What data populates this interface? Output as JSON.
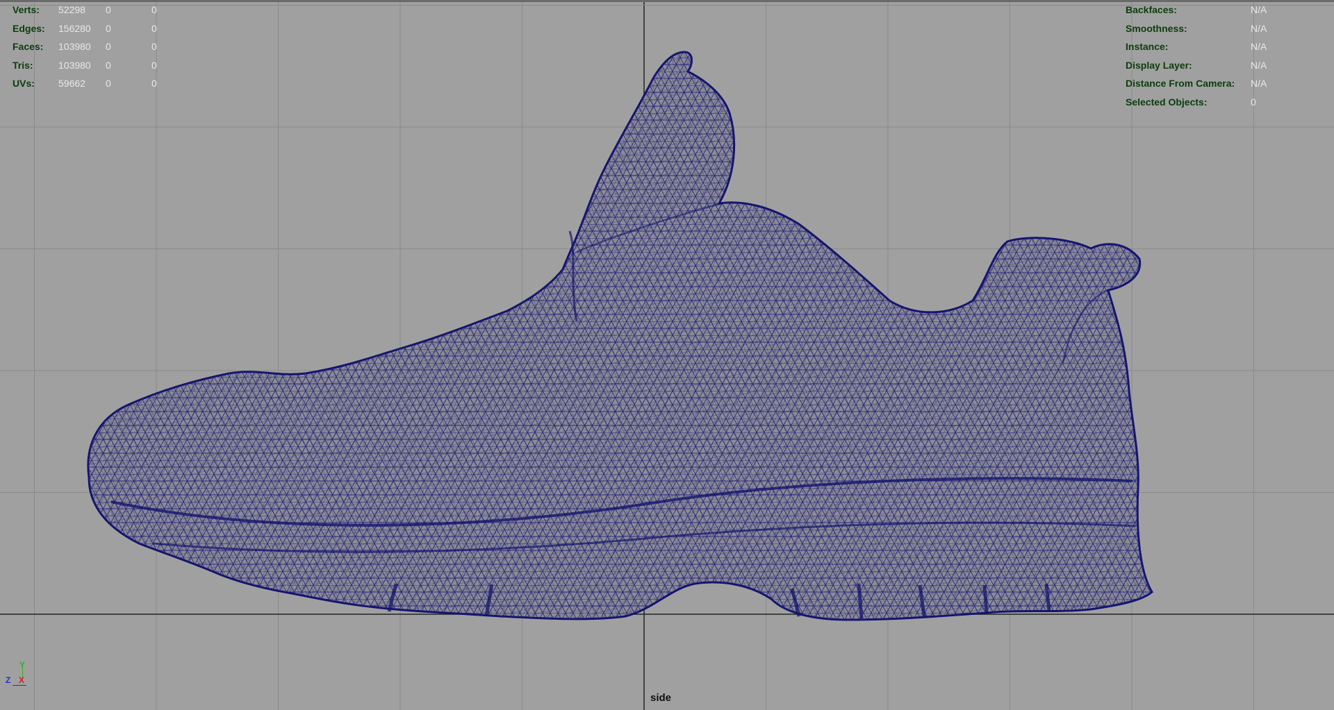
{
  "viewport": {
    "camera_name": "side",
    "background_color": "#a0a0a0",
    "grid_color": "#8a8a8a",
    "axis_line_color": "#222222",
    "wireframe_color": "#1a1a7a"
  },
  "hud_left": [
    {
      "label": "Verts:",
      "values": [
        "52298",
        "0",
        "0"
      ]
    },
    {
      "label": "Edges:",
      "values": [
        "156280",
        "0",
        "0"
      ]
    },
    {
      "label": "Faces:",
      "values": [
        "103980",
        "0",
        "0"
      ]
    },
    {
      "label": "Tris:",
      "values": [
        "103980",
        "0",
        "0"
      ]
    },
    {
      "label": "UVs:",
      "values": [
        "59662",
        "0",
        "0"
      ]
    }
  ],
  "hud_right": [
    {
      "label": "Backfaces:",
      "value": "N/A"
    },
    {
      "label": "Smoothness:",
      "value": "N/A"
    },
    {
      "label": "Instance:",
      "value": "N/A"
    },
    {
      "label": "Display Layer:",
      "value": "N/A"
    },
    {
      "label": "Distance From Camera:",
      "value": "N/A"
    },
    {
      "label": "Selected Objects:",
      "value": "0"
    }
  ],
  "axis_gizmo": {
    "y": "Y",
    "z": "Z",
    "x": "X"
  }
}
